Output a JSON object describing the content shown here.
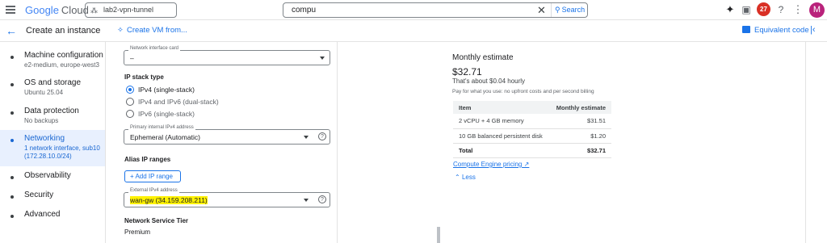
{
  "topbar": {
    "logo_google": "Google",
    "logo_cloud": "Cloud",
    "project": "lab2-vpn-tunnel",
    "search_value": "compu",
    "search_button": "Search",
    "notifications_count": "27",
    "avatar_letter": "M"
  },
  "subbar": {
    "title": "Create an instance",
    "create_vm": "Create VM from...",
    "equivalent_code": "Equivalent code"
  },
  "sidebar": {
    "items": [
      {
        "title": "Machine configuration",
        "subtitle": "e2-medium, europe-west3"
      },
      {
        "title": "OS and storage",
        "subtitle": "Ubuntu 25.04"
      },
      {
        "title": "Data protection",
        "subtitle": "No backups"
      },
      {
        "title": "Networking",
        "subtitle": "1 network interface, sub10 (172.28.10.0/24)"
      },
      {
        "title": "Observability",
        "subtitle": ""
      },
      {
        "title": "Security",
        "subtitle": ""
      },
      {
        "title": "Advanced",
        "subtitle": ""
      }
    ]
  },
  "form": {
    "nic_label": "Network interface card",
    "nic_value": "–",
    "ip_stack_title": "IP stack type",
    "ip_stack_options": [
      "IPv4 (single-stack)",
      "IPv4 and IPv6 (dual-stack)",
      "IPv6 (single-stack)"
    ],
    "primary_label": "Primary internal IPv4 address",
    "primary_value": "Ephemeral (Automatic)",
    "alias_title": "Alias IP ranges",
    "add_ip_range": "Add IP range",
    "external_label": "External IPv4 address",
    "external_value": "wan-gw (34.159.208.211)",
    "tier_title": "Network Service Tier",
    "tier_value": "Premium"
  },
  "estimate": {
    "title": "Monthly estimate",
    "price": "$32.71",
    "hourly": "That's about $0.04 hourly",
    "note": "Pay for what you use: no upfront costs and per second billing",
    "col_item": "Item",
    "col_estimate": "Monthly estimate",
    "rows": [
      {
        "item": "2 vCPU + 4 GB memory",
        "cost": "$31.51"
      },
      {
        "item": "10 GB balanced persistent disk",
        "cost": "$1.20"
      },
      {
        "item": "Total",
        "cost": "$32.71"
      }
    ],
    "pricing_link": "Compute Engine pricing",
    "less": "Less"
  },
  "colors": {
    "accent": "#1a73e8",
    "highlight": "#fff200",
    "active_bg": "#e8f0fe"
  }
}
